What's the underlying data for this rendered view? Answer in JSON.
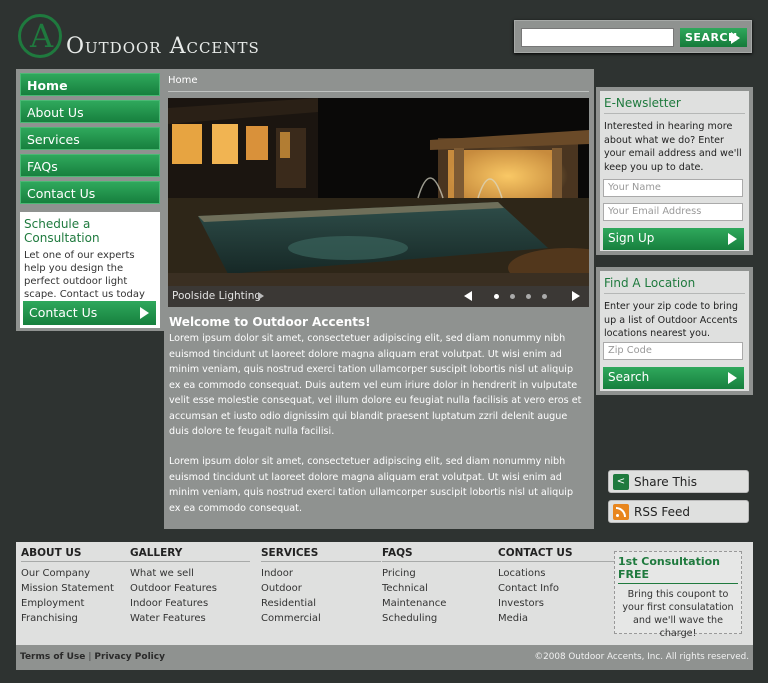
{
  "brand": {
    "logo_letter": "A",
    "name": "Outdoor Accents"
  },
  "search": {
    "placeholder": "",
    "button_label": "SEARCH"
  },
  "nav": [
    {
      "label": "Home"
    },
    {
      "label": "About Us"
    },
    {
      "label": "Services"
    },
    {
      "label": "FAQs"
    },
    {
      "label": "Contact Us"
    }
  ],
  "consultation": {
    "title": "Schedule a Consultation",
    "text": "Let one of our experts help you design the perfect outdoor light scape. Contact us today to set up a time.",
    "button_label": "Contact Us"
  },
  "breadcrumb": "Home",
  "slider": {
    "caption": "Poolside Lighting",
    "slide_count": 4,
    "active_slide": 1
  },
  "main": {
    "heading": "Welcome to Outdoor Accents!",
    "paragraph1": "Lorem ipsum dolor sit amet, consectetuer adipiscing elit, sed diam nonummy nibh euismod tincidunt ut laoreet dolore magna aliquam erat volutpat. Ut wisi enim ad minim veniam, quis nostrud exerci tation ullamcorper suscipit lobortis nisl ut aliquip ex ea commodo consequat. Duis autem vel eum iriure dolor in hendrerit in vulputate velit esse molestie consequat, vel illum dolore eu feugiat nulla facilisis at vero eros et accumsan et iusto odio dignissim qui blandit praesent luptatum zzril delenit augue duis dolore te feugait nulla facilisi.",
    "paragraph2": "Lorem ipsum dolor sit amet, consectetuer adipiscing elit, sed diam nonummy nibh euismod tincidunt ut laoreet dolore magna aliquam erat volutpat. Ut wisi enim ad minim veniam, quis nostrud exerci tation ullamcorper suscipit lobortis nisl ut aliquip ex ea commodo consequat."
  },
  "newsletter": {
    "title": "E-Newsletter",
    "text": "Interested in hearing more about what we do? Enter your email address and we'll keep you up to date.",
    "name_placeholder": "Your Name",
    "email_placeholder": "Your Email Address",
    "button_label": "Sign Up"
  },
  "locator": {
    "title": "Find A Location",
    "text": "Enter your zip code to bring up a list of Outdoor Accents locations nearest you.",
    "zip_placeholder": "Zip Code",
    "button_label": "Search"
  },
  "social": {
    "share_label": "Share This",
    "rss_label": "RSS Feed"
  },
  "footer": {
    "columns": [
      {
        "heading": "ABOUT US",
        "links": [
          "Our Company",
          "Mission Statement",
          "Employment",
          "Franchising"
        ]
      },
      {
        "heading": "GALLERY",
        "links": [
          "What we sell",
          "Outdoor Features",
          "Indoor Features",
          "Water Features"
        ]
      },
      {
        "heading": "SERVICES",
        "links": [
          "Indoor",
          "Outdoor",
          "Residential",
          "Commercial"
        ]
      },
      {
        "heading": "FAQS",
        "links": [
          "Pricing",
          "Technical",
          "Maintenance",
          "Scheduling"
        ]
      },
      {
        "heading": "CONTACT US",
        "links": [
          "Locations",
          "Contact Info",
          "Investors",
          "Media"
        ]
      }
    ],
    "coupon": {
      "title": "1st Consultation FREE",
      "text": "Bring this coupont to your first consulatation and we'll wave the charge!"
    },
    "terms": "Terms of Use",
    "separator": "|",
    "privacy": "Privacy Policy",
    "copyright": "©2008 Outdoor Accents, Inc. All rights reserved."
  },
  "colors": {
    "accent_green": "#1f7a3e",
    "button_green": "#2fa85c",
    "panel_gray": "#8f9290",
    "background": "#2e3331"
  }
}
